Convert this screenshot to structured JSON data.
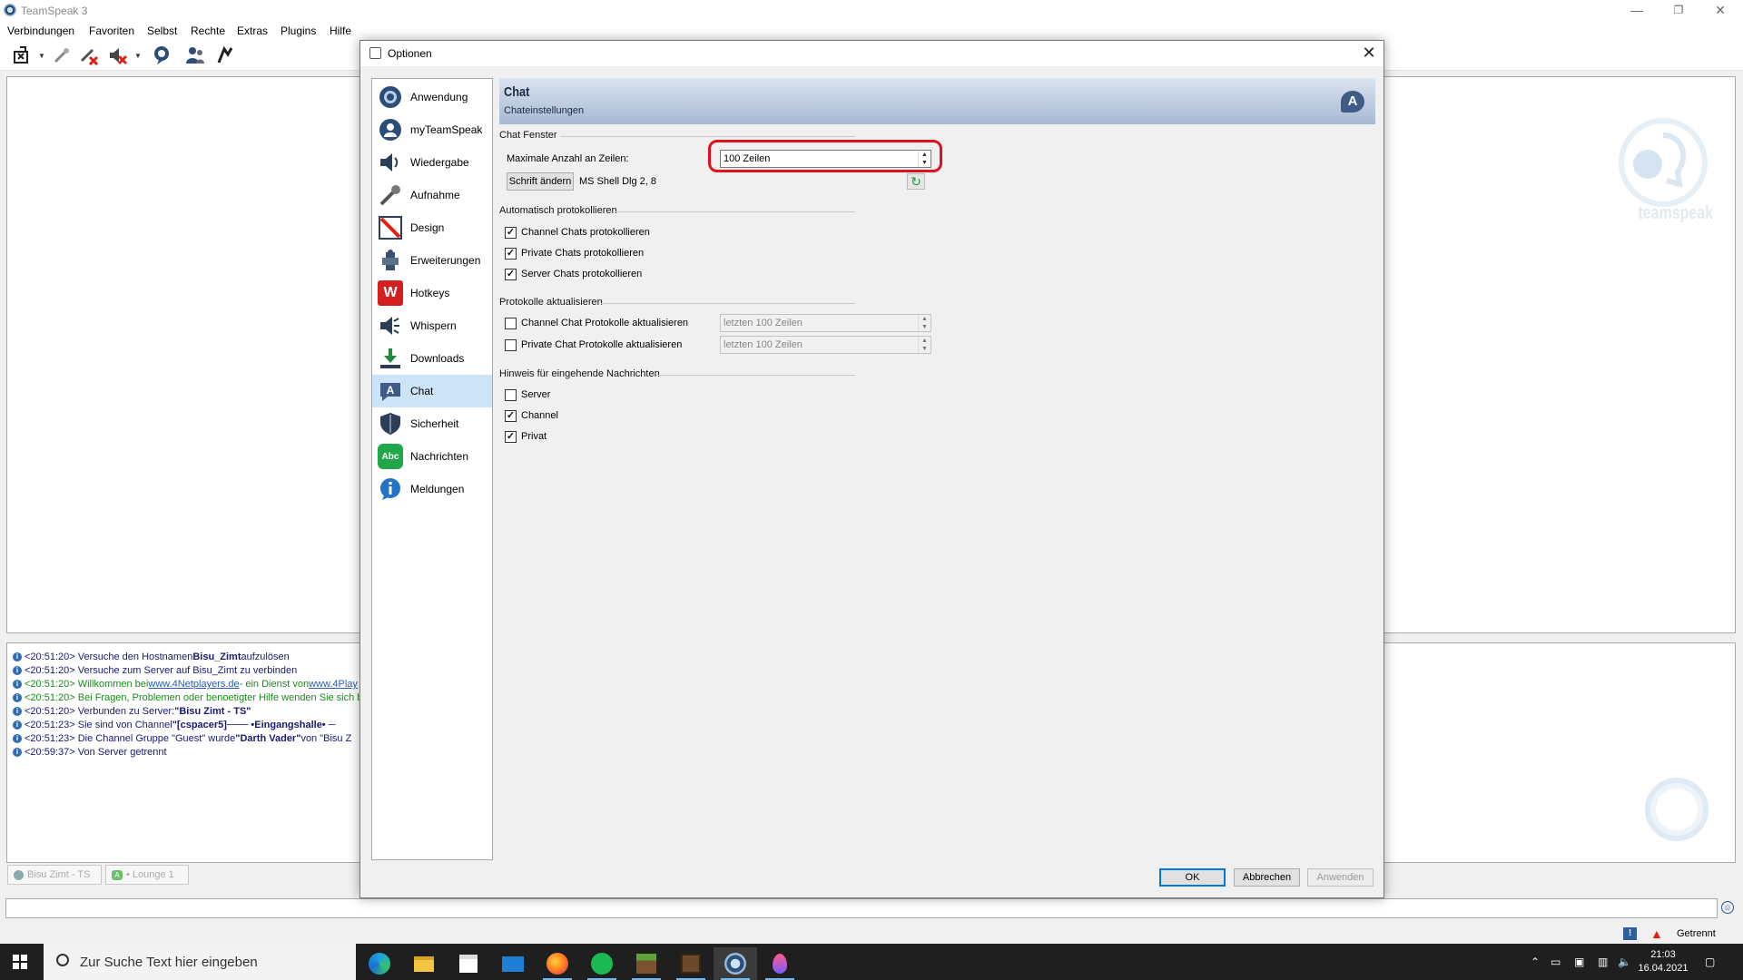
{
  "window": {
    "title": "TeamSpeak 3",
    "menu": [
      "Verbindungen",
      "Favoriten",
      "Selbst",
      "Rechte",
      "Extras",
      "Plugins",
      "Hilfe"
    ]
  },
  "log": [
    {
      "time": "<20:51:20>",
      "text": "Versuche den Hostnamen ",
      "bold": "Bisu_Zimt",
      "rest": " aufzulösen",
      "color": "blue"
    },
    {
      "time": "<20:51:20>",
      "text": "Versuche zum Server auf Bisu_Zimt zu verbinden",
      "bold": "",
      "rest": "",
      "color": "blue"
    },
    {
      "time": "<20:51:20>",
      "text": "Willkommen bei ",
      "link": "www.4Netplayers.de",
      "rest": " - ein Dienst von ",
      "link2": "www.4Play",
      "color": "green"
    },
    {
      "time": "<20:51:20>",
      "text": "Bei Fragen, Problemen oder benoetigter Hilfe wenden Sie sich bit",
      "bold": "",
      "rest": "",
      "color": "green"
    },
    {
      "time": "<20:51:20>",
      "text": "Verbunden zu Server: ",
      "bold": "\"Bisu Zimt - TS\"",
      "rest": "",
      "color": "blue"
    },
    {
      "time": "<20:51:23>",
      "text": "Sie sind von Channel ",
      "bold": "\"[cspacer5]─── •Eingangshalle• ─",
      "rest": "",
      "color": "blue"
    },
    {
      "time": "<20:51:23>",
      "text": "Die Channel Gruppe \"Guest\" wurde ",
      "bold": "\"Darth Vader\"",
      "rest": " von \"Bisu Z",
      "color": "blue"
    },
    {
      "time": "<20:59:37>",
      "text": "Von Server getrennt",
      "bold": "",
      "rest": "",
      "color": "blue"
    }
  ],
  "tabs": {
    "server": "Bisu Zimt - TS",
    "channel": "• Lounge 1"
  },
  "status": {
    "text": "Getrennt"
  },
  "logo": {
    "text": "teamspeak"
  },
  "dialog": {
    "title": "Optionen",
    "nav": [
      {
        "label": "Anwendung",
        "icon": "anwendung-icon"
      },
      {
        "label": "myTeamSpeak",
        "icon": "myteamspeak-icon"
      },
      {
        "label": "Wiedergabe",
        "icon": "speaker-icon"
      },
      {
        "label": "Aufnahme",
        "icon": "microphone-icon"
      },
      {
        "label": "Design",
        "icon": "design-icon"
      },
      {
        "label": "Erweiterungen",
        "icon": "puzzle-icon"
      },
      {
        "label": "Hotkeys",
        "icon": "hotkey-icon"
      },
      {
        "label": "Whispern",
        "icon": "whisper-icon"
      },
      {
        "label": "Downloads",
        "icon": "download-icon"
      },
      {
        "label": "Chat",
        "icon": "chat-icon"
      },
      {
        "label": "Sicherheit",
        "icon": "shield-icon"
      },
      {
        "label": "Nachrichten",
        "icon": "messages-icon"
      },
      {
        "label": "Meldungen",
        "icon": "notifications-icon"
      }
    ],
    "selected_nav": "Chat",
    "banner": {
      "title": "Chat",
      "subtitle": "Chateinstellungen",
      "icon_letter": "A"
    },
    "chat_window": {
      "group_title": "Chat Fenster",
      "max_lines_label": "Maximale Anzahl an Zeilen:",
      "max_lines_value": "100 Zeilen",
      "font_button": "Schrift ändern",
      "font_value": "MS Shell Dlg 2, 8"
    },
    "auto_log": {
      "group_title": "Automatisch protokollieren",
      "items": [
        {
          "label": "Channel Chats protokollieren",
          "checked": true
        },
        {
          "label": "Private Chats protokollieren",
          "checked": true
        },
        {
          "label": "Server Chats protokollieren",
          "checked": true
        }
      ]
    },
    "update_logs": {
      "group_title": "Protokolle aktualisieren",
      "items": [
        {
          "label": "Channel Chat Protokolle aktualisieren",
          "checked": false,
          "value": "letzten 100 Zeilen"
        },
        {
          "label": "Private Chat Protokolle aktualisieren",
          "checked": false,
          "value": "letzten 100 Zeilen"
        }
      ]
    },
    "notifications": {
      "group_title": "Hinweis für eingehende Nachrichten",
      "items": [
        {
          "label": "Server",
          "checked": false
        },
        {
          "label": "Channel",
          "checked": true
        },
        {
          "label": "Privat",
          "checked": true
        }
      ]
    },
    "buttons": {
      "ok": "OK",
      "cancel": "Abbrechen",
      "apply": "Anwenden"
    }
  },
  "taskbar": {
    "search_placeholder": "Zur Suche Text hier eingeben",
    "time": "21:03",
    "date": "16.04.2021"
  },
  "colors": {
    "highlight": "#e0101e",
    "selected_nav": "#cce4f7",
    "banner_top": "#dbe4f0",
    "banner_bottom": "#a7b9d3"
  }
}
